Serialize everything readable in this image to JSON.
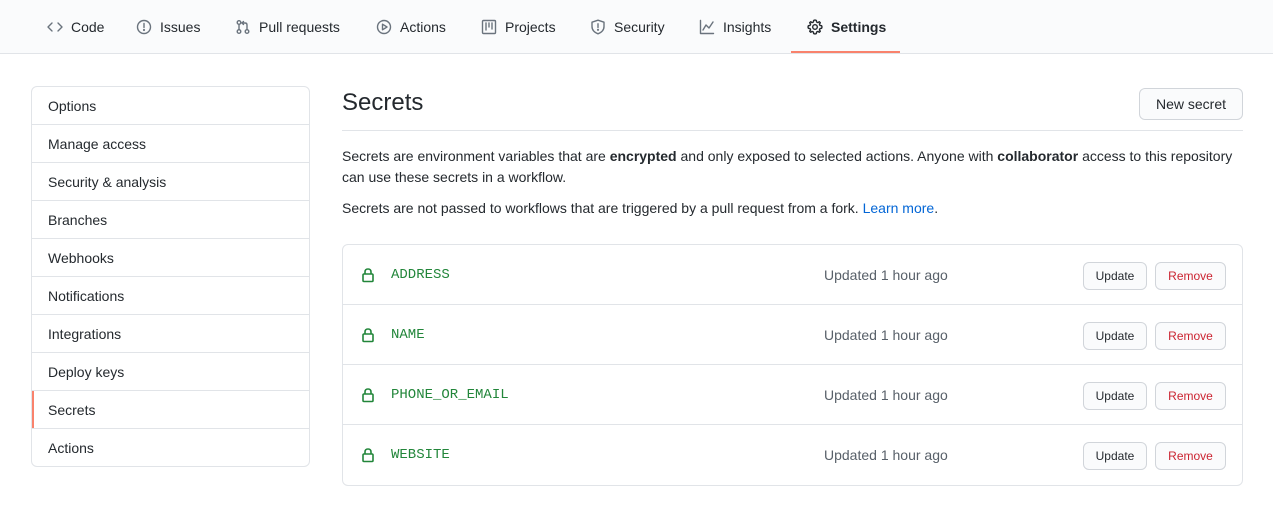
{
  "nav": {
    "tabs": [
      {
        "label": "Code",
        "icon": "code-icon",
        "selected": false
      },
      {
        "label": "Issues",
        "icon": "issue-icon",
        "selected": false
      },
      {
        "label": "Pull requests",
        "icon": "pull-request-icon",
        "selected": false
      },
      {
        "label": "Actions",
        "icon": "play-icon",
        "selected": false
      },
      {
        "label": "Projects",
        "icon": "project-icon",
        "selected": false
      },
      {
        "label": "Security",
        "icon": "shield-icon",
        "selected": false
      },
      {
        "label": "Insights",
        "icon": "graph-icon",
        "selected": false
      },
      {
        "label": "Settings",
        "icon": "gear-icon",
        "selected": true
      }
    ],
    "accent_color": "#f9826c"
  },
  "sidebar": {
    "items": [
      {
        "label": "Options"
      },
      {
        "label": "Manage access"
      },
      {
        "label": "Security & analysis"
      },
      {
        "label": "Branches"
      },
      {
        "label": "Webhooks"
      },
      {
        "label": "Notifications"
      },
      {
        "label": "Integrations"
      },
      {
        "label": "Deploy keys"
      },
      {
        "label": "Secrets",
        "selected": true
      },
      {
        "label": "Actions"
      }
    ]
  },
  "main": {
    "title": "Secrets",
    "new_secret_label": "New secret",
    "description": {
      "part1": "Secrets are environment variables that are ",
      "bold1": "encrypted",
      "part2": " and only exposed to selected actions. Anyone with ",
      "bold2": "collaborator",
      "part3": " access to this repository can use these secrets in a workflow."
    },
    "fork_note": {
      "text": "Secrets are not passed to workflows that are triggered by a pull request from a fork. ",
      "link": "Learn more",
      "end": "."
    },
    "secrets": [
      {
        "name": "ADDRESS",
        "updated": "Updated 1 hour ago",
        "update_label": "Update",
        "remove_label": "Remove"
      },
      {
        "name": "NAME",
        "updated": "Updated 1 hour ago",
        "update_label": "Update",
        "remove_label": "Remove"
      },
      {
        "name": "PHONE_OR_EMAIL",
        "updated": "Updated 1 hour ago",
        "update_label": "Update",
        "remove_label": "Remove"
      },
      {
        "name": "WEBSITE",
        "updated": "Updated 1 hour ago",
        "update_label": "Update",
        "remove_label": "Remove"
      }
    ],
    "secret_color": "#22863a",
    "remove_color": "#cb2431",
    "link_color": "#0366d6"
  }
}
